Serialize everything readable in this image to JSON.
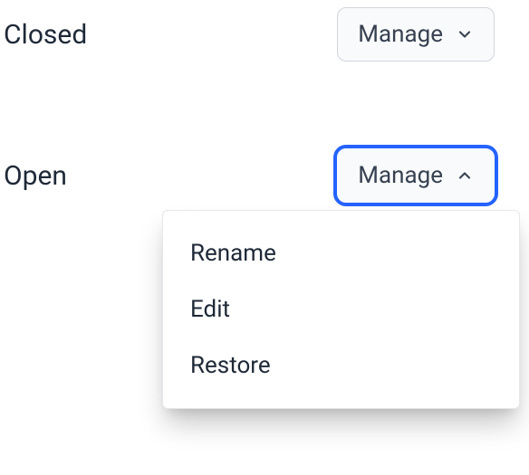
{
  "rows": {
    "closed": {
      "label": "Closed",
      "button_label": "Manage"
    },
    "open": {
      "label": "Open",
      "button_label": "Manage"
    }
  },
  "menu": {
    "items": [
      "Rename",
      "Edit",
      "Restore"
    ]
  }
}
